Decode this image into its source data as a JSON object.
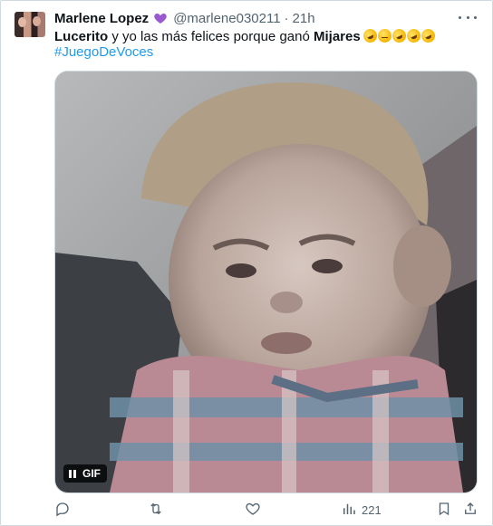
{
  "tweet": {
    "author_name": "Marlene Lopez",
    "author_badge_icon": "purple-heart-icon",
    "handle": "@marlene030211",
    "separator": "·",
    "time": "21h",
    "text_part1": "Lucerito",
    "text_part2": " y yo las más felices porque ganó ",
    "text_part3": "Mijares",
    "emoji_icons": [
      "rofl-emoji-icon",
      "neutral-face-emoji-icon",
      "rofl-emoji-icon",
      "rofl-emoji-icon",
      "rofl-emoji-icon"
    ],
    "hashtag": "#JuegoDeVoces"
  },
  "media": {
    "type_label": "GIF",
    "control_icon": "pause-icon"
  },
  "actions": {
    "reply_icon": "reply-icon",
    "retweet_icon": "retweet-icon",
    "like_icon": "like-icon",
    "views_icon": "views-icon",
    "views_count": "221",
    "bookmark_icon": "bookmark-icon",
    "share_icon": "share-icon"
  },
  "colors": {
    "link": "#1d9bf0",
    "secondary_text": "#536471",
    "badge": "#9b59d0"
  }
}
